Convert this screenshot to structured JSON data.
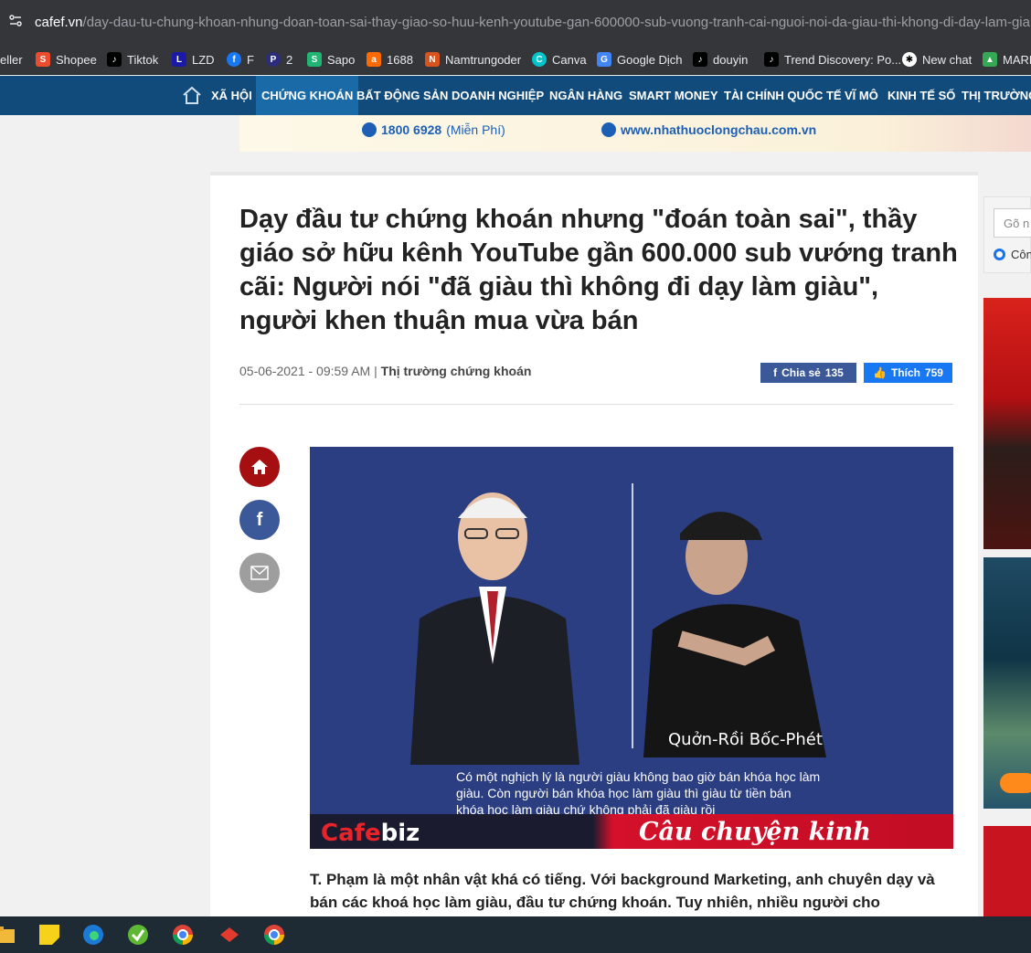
{
  "browser": {
    "url_domain": "cafef.vn",
    "url_path": "/day-dau-tu-chung-khoan-nhung-doan-toan-sai-thay-giao-so-huu-kenh-youtube-gan-600000-sub-vuong-tranh-cai-nguoi-noi-da-giau-thi-khong-di-day-lam-giau-ngu",
    "bookmarks": [
      {
        "label": "eller",
        "icon": "none",
        "color": ""
      },
      {
        "label": "Shopee",
        "icon": "shopee-icon",
        "color": "#ee4d2d"
      },
      {
        "label": "Tiktok",
        "icon": "tiktok-icon",
        "color": "#000000"
      },
      {
        "label": "LZD",
        "icon": "lazada-icon",
        "color": "#1a1aa6"
      },
      {
        "label": "F",
        "icon": "facebook-icon",
        "color": "#1877f2"
      },
      {
        "label": "2",
        "icon": "p-icon",
        "color": "#2b2d7a"
      },
      {
        "label": "Sapo",
        "icon": "sapo-icon",
        "color": "#21b573"
      },
      {
        "label": "1688",
        "icon": "1688-icon",
        "color": "#ff6a00"
      },
      {
        "label": "Namtrungoder",
        "icon": "namtrung-icon",
        "color": "#d9531e"
      },
      {
        "label": "Canva",
        "icon": "canva-icon",
        "color": "#00c4cc"
      },
      {
        "label": "Google Dịch",
        "icon": "translate-icon",
        "color": "#4285f4"
      },
      {
        "label": "douyin",
        "icon": "douyin-icon",
        "color": "#000000"
      },
      {
        "label": "Trend Discovery: Po...",
        "icon": "tiktok-icon",
        "color": "#000000"
      },
      {
        "label": "New chat",
        "icon": "chatgpt-icon",
        "color": "#ffffff"
      },
      {
        "label": "MARK",
        "icon": "drive-icon",
        "color": "#34a853"
      }
    ]
  },
  "nav": {
    "items": [
      "XÃ HỘI",
      "CHỨNG KHOÁN",
      "BẤT ĐỘNG SẢN",
      "DOANH NGHIỆP",
      "NGÂN HÀNG",
      "SMART MONEY",
      "TÀI CHÍNH QUỐC TẾ",
      "VĨ MÔ",
      "KINH TẾ SỐ",
      "THỊ TRƯỜNG"
    ],
    "active": "CHỨNG KHOÁN"
  },
  "banner": {
    "phone": "1800 6928",
    "phone_note": "(Miễn Phí)",
    "website": "www.nhathuoclongchau.com.vn"
  },
  "article": {
    "title": "Dạy đầu tư chứng khoán nhưng \"đoán toàn sai\", thầy giáo sở hữu kênh YouTube gần 600.000 sub vướng tranh cãi: Người nói \"đã giàu thì không đi dạy làm giàu\", người khen thuận mua vừa bán",
    "date": "05-06-2021 - 09:59 AM",
    "sep": "|",
    "category": "Thị trường chứng khoán",
    "share_label": "Chia sẻ",
    "share_count": "135",
    "like_label": "Thích",
    "like_count": "759",
    "image": {
      "right_name": "Quởn-Rồi Bốc-Phét",
      "quote": "Có một nghịch lý là người giàu không bao giờ bán khóa học làm giàu. Còn người bán khóa học làm giàu thì giàu từ tiền bán khóa học làm giàu chứ không phải đã giàu rồi",
      "logo_c": "Cafe",
      "logo_rest": "biz",
      "story": "Câu chuyện kinh doanh"
    },
    "body": "T. Phạm là một nhân vật khá có tiếng. Với background Marketing, anh chuyên dạy và bán các khoá học làm giàu, đầu tư chứng khoán. Tuy nhiên, nhiều người cho"
  },
  "sidebar": {
    "search_placeholder": "Gõ n",
    "radio_label": "Côn"
  },
  "colors": {
    "nav_bg": "#114b7c",
    "nav_active": "#1b6aa8",
    "fb_share": "#3b5998",
    "fb_like": "#1877f2",
    "home_btn": "#a50f12",
    "fb_btn": "#3b5998",
    "mail_btn": "#9e9e9e"
  }
}
